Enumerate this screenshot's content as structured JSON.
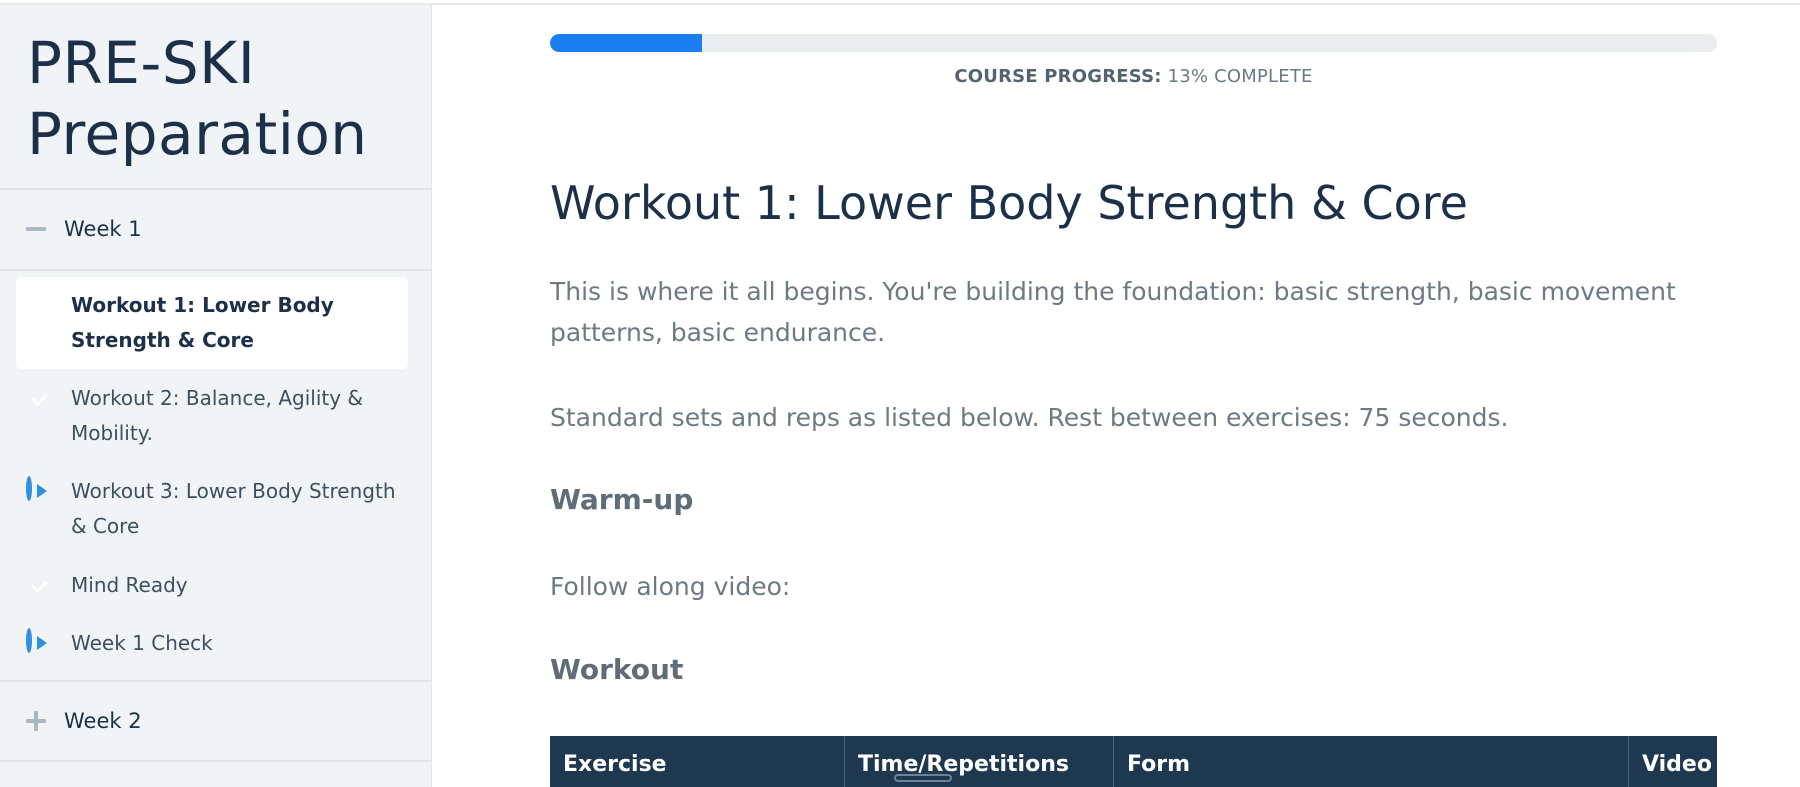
{
  "sidebar": {
    "course_title_line1": "PRE-SKI",
    "course_title_line2": "Preparation",
    "weeks": [
      {
        "label": "Week 1",
        "state": "expanded"
      },
      {
        "label": "Week 2",
        "state": "collapsed"
      }
    ],
    "lessons": [
      {
        "label": "Workout 1: Lower Body Strength & Core",
        "status": "check-icon",
        "active": true
      },
      {
        "label": "Workout 2: Balance, Agility & Mobility.",
        "status": "check-icon",
        "active": false
      },
      {
        "label": "Workout 3: Lower Body Strength & Core",
        "status": "play-icon",
        "active": false
      },
      {
        "label": "Mind Ready",
        "status": "check-icon",
        "active": false
      },
      {
        "label": "Week 1 Check",
        "status": "play-icon",
        "active": false
      }
    ]
  },
  "progress": {
    "label": "COURSE PROGRESS:",
    "value_text": "13% COMPLETE",
    "percent": 13,
    "fill_color": "#1a7ef0"
  },
  "content": {
    "title": "Workout 1: Lower Body Strength & Core",
    "intro": "This is where it all begins. You're building the foundation: basic strength, basic movement patterns, basic endurance.",
    "rest_text": "Standard sets and reps as listed below. Rest between exercises: 75 seconds.",
    "warmup_heading": "Warm-up",
    "follow_text": "Follow along video:",
    "workout_heading": "Workout",
    "table_headers": [
      "Exercise",
      "Time/Repetitions",
      "Form",
      "Video"
    ]
  },
  "colors": {
    "check": "#2dba4e",
    "play": "#2f8fe0",
    "table_header_bg": "#1e3850"
  }
}
